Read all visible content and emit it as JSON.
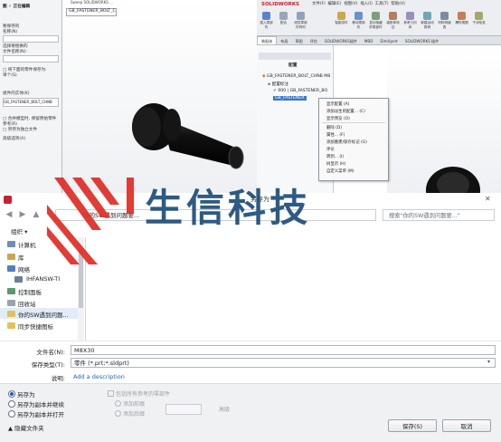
{
  "left_panel": {
    "header": "图 ✓ 正在编辑",
    "lines": [
      "要保存的",
      "名称(N)",
      "",
      "选择要替换的",
      "文件名称(N):",
      "",
      "□ 将下面的零件保存为:",
      "单个(S)",
      "",
      "组件的实体(K)",
      "GB_FASTENER_BOLT_CHNB",
      "",
      "□ 合并模型时, 保留原始零件",
      "参考(R)",
      "",
      "□ 另存为独立文件",
      "",
      "高级选项(A)"
    ]
  },
  "viewport_left": {
    "tab": "GB_FASTENER_BOLT_C",
    "header_text": "Sweep  SOLIDWORKS  ..."
  },
  "sw": {
    "logo": "SOLIDWORKS",
    "menu": [
      "文件(F)",
      "编辑(E)",
      "视图(V)",
      "插入(I)",
      "工具(T)",
      "帮助(H)"
    ],
    "toolbar_buttons": [
      "插入零部件",
      "配合",
      "线性零部件阵列",
      "智能扣件",
      "移动零部件",
      "显示隐藏的零部件",
      "装配体特征",
      "参考几何体",
      "新建运动算例",
      "材料明细表",
      "爆炸视图",
      "干涉检查"
    ],
    "tabs": [
      "装配体",
      "布局",
      "草图",
      "评估",
      "SOLIDWORKS插件",
      "MBD",
      "DimXpert",
      "SOLIDWORKS 插件",
      "SOLIDWORKS MBD"
    ],
    "tree": {
      "header": "配置",
      "items": [
        "GB_FASTENER_BOLT_CHNB M8",
        "配置标注",
        "000 | GB_FASTENER_BO",
        "GB_FASTENER"
      ]
    },
    "context_menu": [
      "显示配置 (A)",
      "添加派生的配置... (C)",
      "显示预览 (O)",
      "删除 (D)",
      "属性... (F)",
      "添加重建/保存标记 (G)",
      "评论",
      "转到... (I)",
      "树显示 (H)",
      "自定义菜单 (M)"
    ]
  },
  "dialog": {
    "title": "另存为",
    "close": "✕",
    "address": "你的SW遇到问题要...",
    "search_placeholder": "搜索\"你的SW遇到问题要...\"",
    "organize": "组织 ▾",
    "nav_items": [
      "计算机",
      "库",
      "网络",
      "IHFANSW-TI",
      "控制面板",
      "回收站",
      "你的SW遇到问题...",
      "同步快捷图标"
    ],
    "file_name_label": "文件名(N):",
    "file_name_value": "M8X30",
    "save_type_label": "保存类型(T):",
    "save_type_value": "零件 (*.prt;*.sldprt)",
    "desc_label": "说明:",
    "desc_link": "Add a description",
    "radios": [
      "另存为",
      "另存为副本并继续",
      "另存为副本并打开"
    ],
    "disabled_options": [
      "包括所有参考的零部件",
      "添加前缀",
      "添加后缀",
      "高级"
    ],
    "hide_folders": "▲ 隐藏文件夹",
    "save_button": "保存(S)",
    "cancel_button": "取消"
  },
  "watermark": {
    "text": "生信科技"
  },
  "colors": {
    "sw_red": "#c8202c",
    "watermark_blue": "#1f4f7a",
    "link_blue": "#1a63c6"
  }
}
